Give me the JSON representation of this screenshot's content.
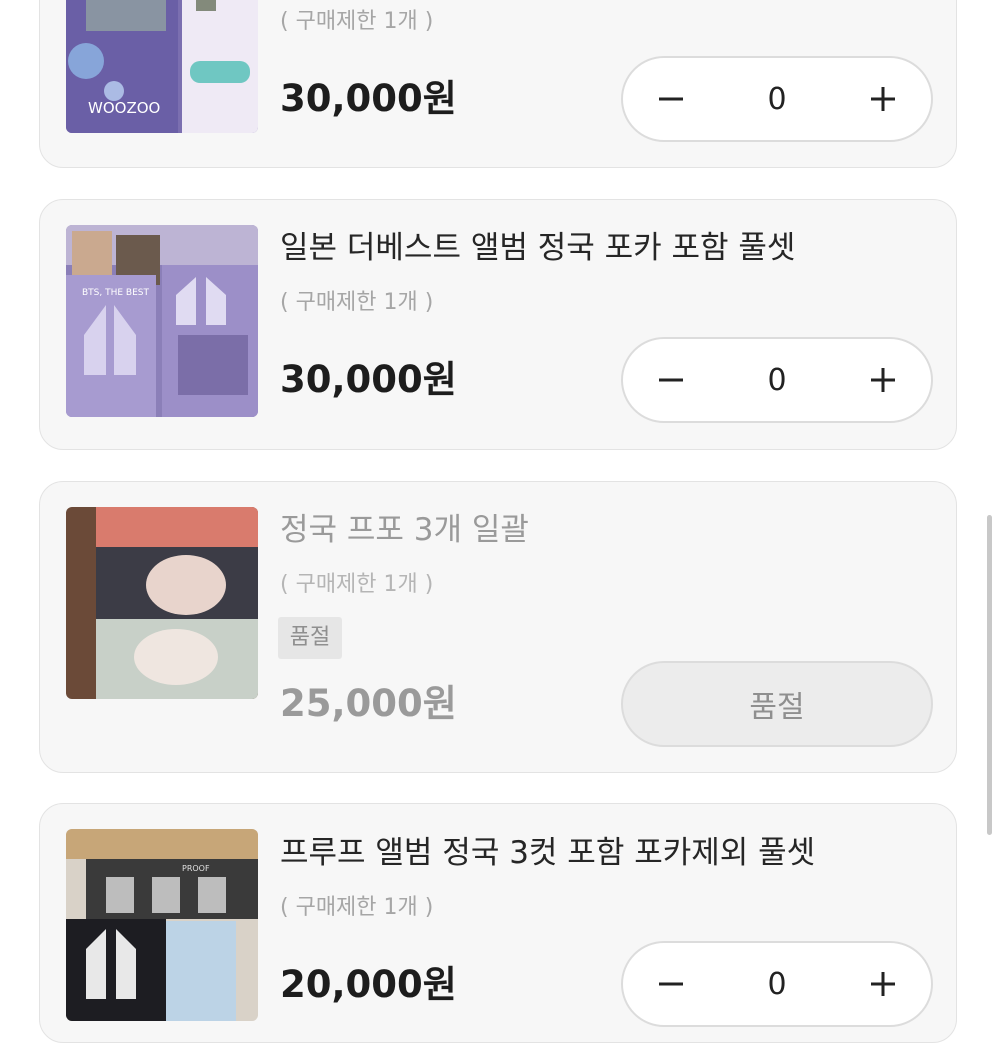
{
  "products": [
    {
      "title": "",
      "limit": "( 구매제한 1개 )",
      "price": "30,000원",
      "quantity": "0",
      "image_text": "WOOZOO",
      "sold_out": false
    },
    {
      "title": "일본 더베스트 앨범 정국 포카 포함 풀셋",
      "limit": "( 구매제한 1개 )",
      "price": "30,000원",
      "quantity": "0",
      "image_text": "BTS, THE BEST",
      "sold_out": false
    },
    {
      "title": "정국 프포 3개 일괄",
      "limit": "( 구매제한 1개 )",
      "badge": "품절",
      "price": "25,000원",
      "button": "품절",
      "sold_out": true
    },
    {
      "title": "프루프 앨범 정국 3컷 포함 포카제외 풀셋",
      "limit": "( 구매제한 1개 )",
      "price": "20,000원",
      "quantity": "0",
      "image_text": "PROOF",
      "sold_out": false
    }
  ],
  "icons": {
    "decrease": "minus-icon",
    "increase": "plus-icon"
  },
  "colors": {
    "card_bg": "#f7f7f7",
    "border": "#e3e3e3",
    "soldout_text": "#9a9a9a"
  }
}
